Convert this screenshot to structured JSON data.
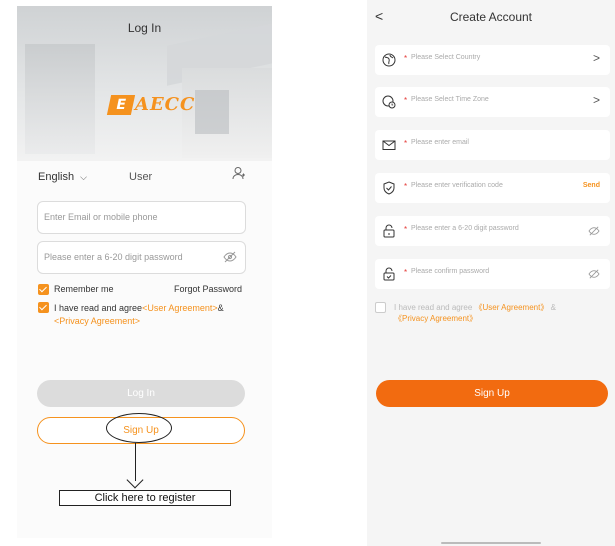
{
  "login": {
    "title": "Log In",
    "logo_mark": "E",
    "logo_text": "AECC",
    "language": "English",
    "user_label": "User",
    "email_placeholder": "Enter Email or mobile phone",
    "password_placeholder": "Please enter a 6-20 digit password",
    "remember_me": "Remember me",
    "forgot_password": "Forgot Password",
    "agree_prefix": "I have read and agree",
    "user_agreement": "<User Agreement>",
    "amp": "&",
    "privacy_agreement": "<Privacy Agreement>",
    "login_button": "Log In",
    "signup_button": "Sign Up",
    "annotation": "Click here to register"
  },
  "create": {
    "back": "<",
    "title": "Create Account",
    "fields": [
      {
        "icon": "globe-icon",
        "placeholder": "Please Select Country",
        "suffix": ">"
      },
      {
        "icon": "timezone-icon",
        "placeholder": "Please Select Time Zone",
        "suffix": ">"
      },
      {
        "icon": "mail-icon",
        "placeholder": "Please enter email",
        "suffix": ""
      },
      {
        "icon": "shield-check-icon",
        "placeholder": "Please enter verification code",
        "suffix": "Send"
      },
      {
        "icon": "lock-icon",
        "placeholder": "Please enter a 6-20 digit password",
        "suffix": "eye-off"
      },
      {
        "icon": "lock-check-icon",
        "placeholder": "Please confirm password",
        "suffix": "eye-off"
      }
    ],
    "required_mark": "*",
    "agree_prefix": "I have read and agree",
    "user_agreement": "《User Agreement》",
    "amp": "&",
    "privacy_agreement": "《Privacy Agreement》",
    "signup_button": "Sign Up"
  },
  "colors": {
    "accent": "#f5921e",
    "primary_button": "#f26b10",
    "required": "#e53935"
  }
}
